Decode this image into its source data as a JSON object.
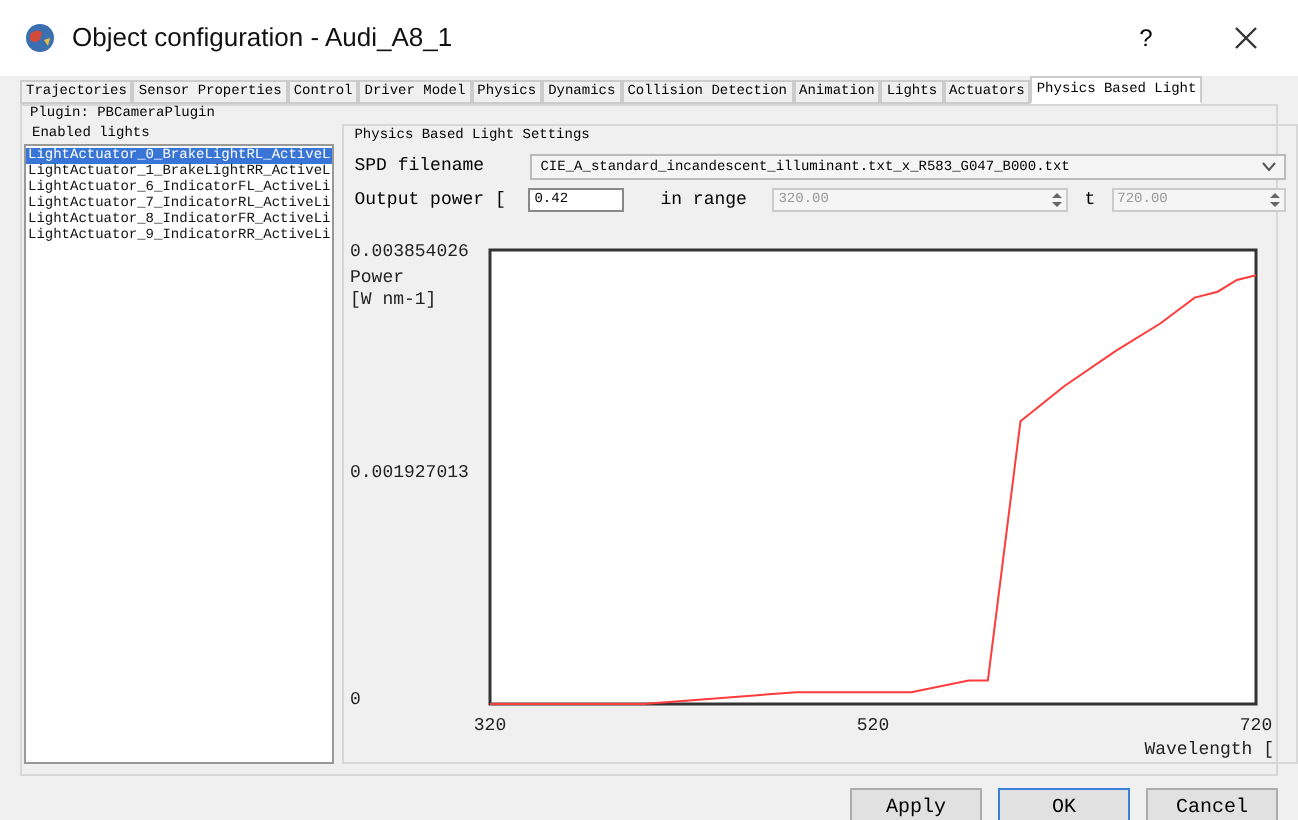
{
  "window": {
    "title": "Object configuration - Audi_A8_1",
    "help": "?"
  },
  "tabs": [
    {
      "label": "Trajectories",
      "selected": false
    },
    {
      "label": "Sensor Properties",
      "selected": false
    },
    {
      "label": "Control",
      "selected": false
    },
    {
      "label": "Driver Model",
      "selected": false
    },
    {
      "label": "Physics",
      "selected": false
    },
    {
      "label": "Dynamics",
      "selected": false
    },
    {
      "label": "Collision Detection",
      "selected": false
    },
    {
      "label": "Animation",
      "selected": false
    },
    {
      "label": "Lights",
      "selected": false
    },
    {
      "label": "Actuators",
      "selected": false
    },
    {
      "label": "Physics Based Light",
      "selected": true
    }
  ],
  "plugin": "Plugin: PBCameraPlugin",
  "enabled_lights": {
    "title": "Enabled lights",
    "items": [
      {
        "label": "LightActuator_0_BrakeLightRL_ActiveL",
        "selected": true
      },
      {
        "label": "LightActuator_1_BrakeLightRR_ActiveL",
        "selected": false
      },
      {
        "label": "LightActuator_6_IndicatorFL_ActiveLi",
        "selected": false
      },
      {
        "label": "LightActuator_7_IndicatorRL_ActiveLi",
        "selected": false
      },
      {
        "label": "LightActuator_8_IndicatorFR_ActiveLi",
        "selected": false
      },
      {
        "label": "LightActuator_9_IndicatorRR_ActiveLi",
        "selected": false
      }
    ]
  },
  "settings": {
    "title": "Physics Based Light Settings",
    "spd_label": "SPD filename",
    "spd_value": "CIE_A_standard_incandescent_illuminant.txt_x_R583_G047_B000.txt",
    "power_label": "Output power [",
    "power_value": "0.42",
    "range_label": "in range",
    "range_from": "320.00",
    "range_to_label": "t",
    "range_to": "720.00",
    "chart_data": {
      "type": "line",
      "xlabel": "Wavelength [",
      "ylabel": "Power [W nm-1]",
      "x": [
        320,
        400,
        480,
        540,
        570,
        580,
        597,
        620,
        647,
        670,
        688,
        700,
        710,
        720
      ],
      "series": [
        {
          "color": "#ff3b3b",
          "values": [
            0,
            0,
            0.0001,
            0.0001,
            0.0002,
            0.0002,
            0.0024,
            0.0027,
            0.003,
            0.00323,
            0.00345,
            0.0035,
            0.0036,
            0.00364
          ]
        }
      ],
      "xlim": [
        320,
        720
      ],
      "ylim": [
        0,
        0.003854026
      ],
      "xticks": [
        320,
        520,
        720
      ],
      "yticks": [
        0,
        0.001927013,
        0.003854026
      ]
    }
  },
  "buttons": [
    "Apply",
    "OK",
    "Cancel"
  ]
}
